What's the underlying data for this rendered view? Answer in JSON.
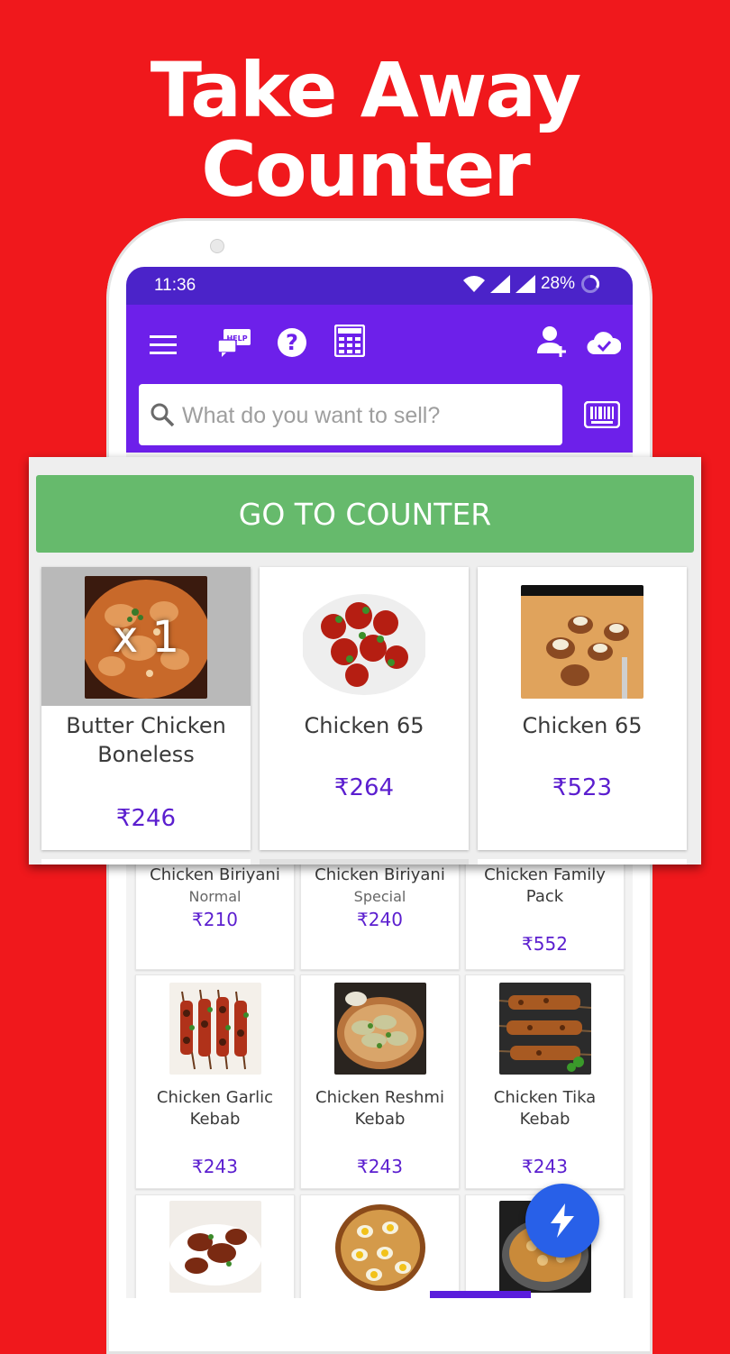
{
  "headline": {
    "line1": "Take Away",
    "line2": "Counter"
  },
  "status_bar": {
    "time": "11:36",
    "battery": "28%"
  },
  "app_bar": {
    "icons": [
      "menu-icon",
      "help-chat-icon",
      "question-icon",
      "calculator-icon",
      "add-user-icon",
      "cloud-sync-icon"
    ],
    "help_badge": "HELP"
  },
  "search": {
    "placeholder": "What do you want to sell?"
  },
  "counter_button": {
    "label": "GO TO COUNTER"
  },
  "popup_items": [
    {
      "name_line1": "Butter Chicken",
      "name_line2": "Boneless",
      "price": "₹246",
      "quantity": "x 1",
      "selected": true
    },
    {
      "name_line1": "Chicken 65",
      "name_line2": "",
      "price": "₹264"
    },
    {
      "name_line1": "Chicken 65",
      "name_line2": "",
      "price": "₹523"
    }
  ],
  "grid_row1": [
    {
      "name_line1": "Chicken Biriyani",
      "name_line2": "",
      "sub": "Normal",
      "price": "₹210"
    },
    {
      "name_line1": "Chicken Biriyani",
      "name_line2": "",
      "sub": "Special",
      "price": "₹240"
    },
    {
      "name_line1": "Chicken Family",
      "name_line2": "Pack",
      "sub": "",
      "price": "₹552"
    }
  ],
  "grid_row2": [
    {
      "name_line1": "Chicken Garlic",
      "name_line2": "Kebab",
      "price": "₹243"
    },
    {
      "name_line1": "Chicken Reshmi",
      "name_line2": "Kebab",
      "price": "₹243"
    },
    {
      "name_line1": "Chicken Tika",
      "name_line2": "Kebab",
      "price": "₹243"
    }
  ],
  "colors": {
    "background": "#f0181c",
    "app_bar": "#6d20ea",
    "status_bar": "#4b23c9",
    "counter_button": "#66ba6c",
    "price": "#5b1ecf",
    "fab": "#2860e8"
  }
}
